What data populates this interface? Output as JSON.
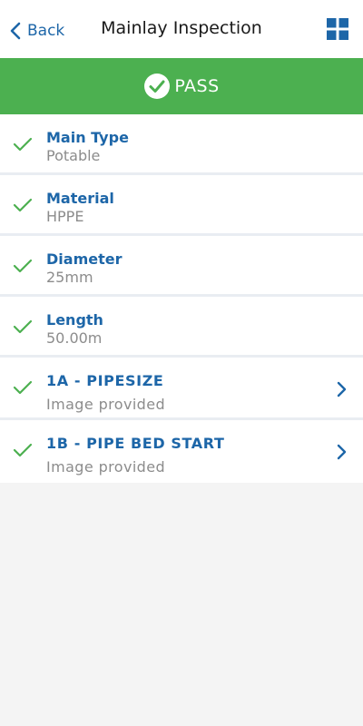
{
  "header": {
    "back_label": "Back",
    "title": "Mainlay Inspection",
    "accent": "#1d66a8"
  },
  "status": {
    "label": "PASS",
    "color": "#4cb050"
  },
  "items": [
    {
      "label": "Main Type",
      "value": "Potable",
      "navigable": false
    },
    {
      "label": "Material",
      "value": "HPPE",
      "navigable": false
    },
    {
      "label": "Diameter",
      "value": "25mm",
      "navigable": false
    },
    {
      "label": "Length",
      "value": "50.00m",
      "navigable": false
    },
    {
      "label": "1A - PIPESIZE",
      "value": "Image provided",
      "navigable": true
    },
    {
      "label": "1B - PIPE BED START",
      "value": "Image provided",
      "navigable": true
    }
  ],
  "icons": {
    "back": "chevron-left-icon",
    "menu": "grid-icon",
    "status": "check-circle-icon",
    "item_state": "check-icon",
    "item_nav": "chevron-right-icon"
  }
}
